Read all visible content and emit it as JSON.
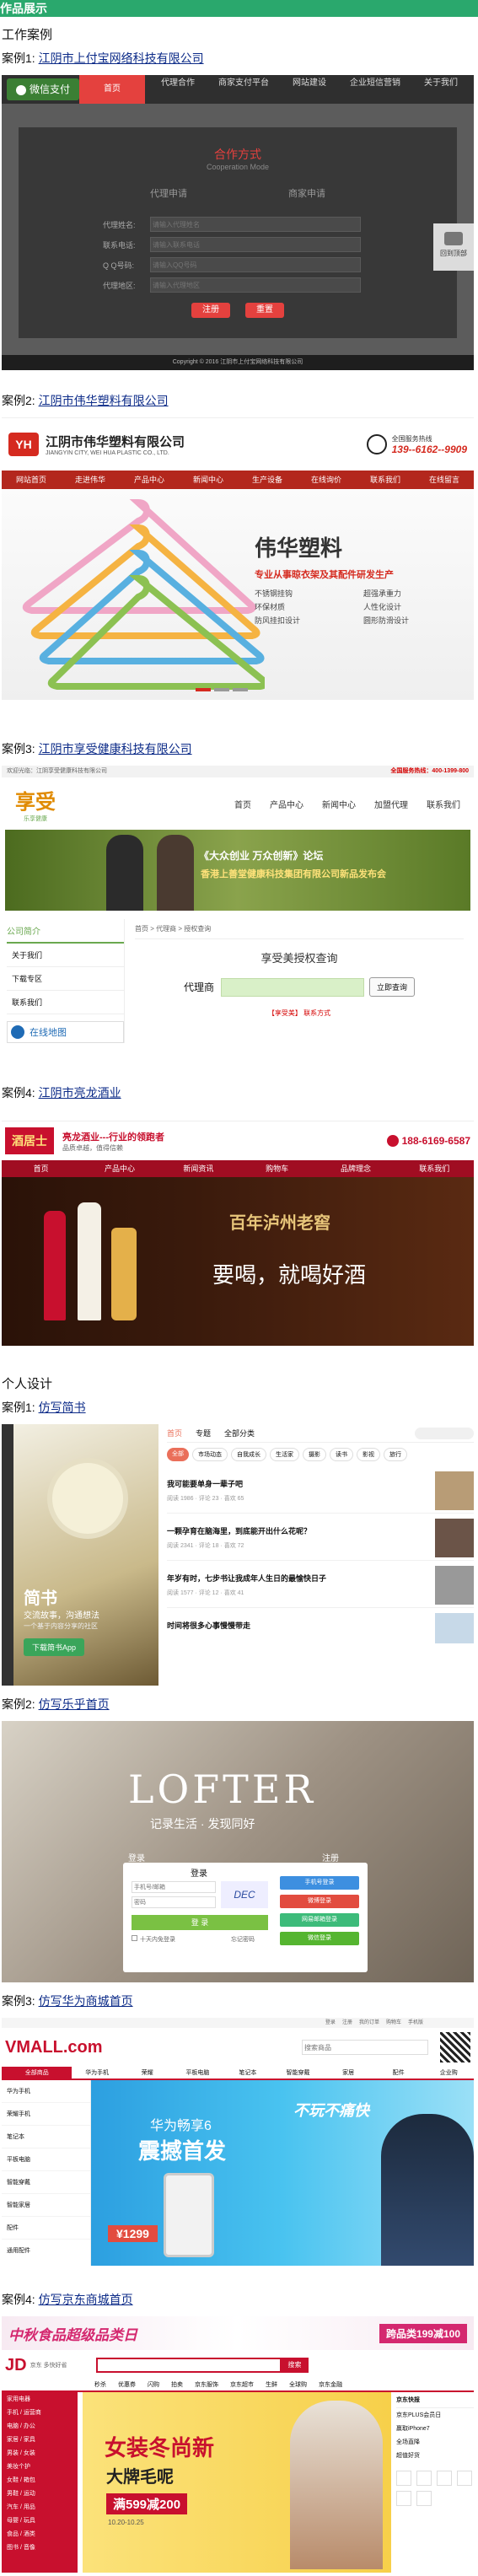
{
  "header": {
    "title": "作品展示"
  },
  "sections": {
    "work": "工作案例",
    "personal": "个人设计"
  },
  "cases": [
    {
      "label": "案例1:",
      "link": "江阴市上付宝网络科技有限公司"
    },
    {
      "label": "案例2:",
      "link": "江阴市伟华塑料有限公司"
    },
    {
      "label": "案例3:",
      "link": "江阴市享受健康科技有限公司"
    },
    {
      "label": "案例4:",
      "link": "江阴市亮龙酒业"
    },
    {
      "label": "案例1:",
      "link": "仿写简书"
    },
    {
      "label": "案例2:",
      "link": "仿写乐乎首页"
    },
    {
      "label": "案例3:",
      "link": "仿写华为商城首页"
    },
    {
      "label": "案例4:",
      "link": "仿写京东商城首页"
    }
  ],
  "s1": {
    "logo": "微信支付",
    "nav": [
      "首页",
      "代理合作",
      "商家支付平台",
      "网站建设",
      "企业短信营销",
      "关于我们"
    ],
    "title": "合作方式",
    "subtitle": "Cooperation Mode",
    "tab1": "代理申请",
    "tab2": "商家申请",
    "fields": [
      "代理姓名:",
      "联系电话:",
      "Q Q号码:",
      "代理地区:"
    ],
    "placeholders": [
      "请输入代理姓名",
      "请输入联系电话",
      "请输入QQ号码",
      "请输入代理地区"
    ],
    "btn1": "注册",
    "btn2": "重置",
    "side": "回到顶部",
    "footer": "Copyright © 2016 江阴市上付宝网络科技有限公司"
  },
  "s2": {
    "logo": "YH",
    "cn": "江阴市伟华塑料有限公司",
    "en": "JIANGYIN CITY, WEI HUA PLASTIC CO., LTD.",
    "hotline_label": "全国服务热线",
    "phone": "139--6162--9909",
    "nav": [
      "网站首页",
      "走进伟华",
      "产品中心",
      "新闻中心",
      "生产设备",
      "在线询价",
      "联系我们",
      "在线留言"
    ],
    "brand": "伟华塑料",
    "slogan": "专业从事晾衣架及其配件研发生产",
    "features": [
      "不锈钢挂钩",
      "环保材质",
      "防风挂扣设计",
      "超强承重力",
      "人性化设计",
      "圆形防滑设计"
    ]
  },
  "s3": {
    "topleft": "欢迎光临：江阴享受健康科技有限公司",
    "topright": "全国服务热线：400-1399-800",
    "logo": "享受",
    "logo_sub": "乐享健康",
    "nav": [
      "首页",
      "产品中心",
      "新闻中心",
      "加盟代理",
      "联系我们"
    ],
    "banner1": "《大众创业 万众创新》论坛",
    "banner2": "香港上善堂健康科技集团有限公司新品发布会",
    "side_title": "公司简介",
    "side_items": [
      "关于我们",
      "下载专区",
      "联系我们"
    ],
    "side_map": "在线地图",
    "crumb": "首页 > 代理商 > 授权查询",
    "query_title": "享受美授权查询",
    "query_label": "代理商",
    "query_btn": "立即查询",
    "contact": "【享受美】 联系方式"
  },
  "s4": {
    "logo": "酒居士",
    "brand_title": "亮龙酒业---行业的领跑者",
    "brand_desc": "品质卓越，值得信赖",
    "phone": "188-6169-6587",
    "nav": [
      "首页",
      "产品中心",
      "新闻资讯",
      "购物车",
      "品牌理念",
      "联系我们"
    ],
    "banner_h": "百年泸州老窖",
    "banner_main": "要喝，就喝好酒"
  },
  "s5": {
    "tabs": [
      "首页",
      "专题",
      "全部分类"
    ],
    "cats": [
      "全部",
      "市场动态",
      "自我成长",
      "生活家",
      "摄影",
      "读书",
      "影视",
      "旅行"
    ],
    "feed": [
      {
        "title": "我可能要单身一辈子吧",
        "meta": "阅读 1986 · 评论 23 · 喜欢 65"
      },
      {
        "title": "一颗孕育在脑海里，到底能开出什么花呢？",
        "meta": "阅读 2341 · 评论 18 · 喜欢 72"
      },
      {
        "title": "年岁有时，七步书让我成年人生日的最愉快日子",
        "meta": "阅读 1577 · 评论 12 · 喜欢 41"
      },
      {
        "title": "时间将很多心事慢慢带走",
        "meta": "阅读 890 · 评论 9 · 喜欢 27"
      }
    ],
    "brand": "简书",
    "brand_sub": "交流故事，沟通想法",
    "brand_desc": "一个基于内容分享的社区",
    "download": "下载简书App"
  },
  "s6": {
    "brand": "LOFTER",
    "slogan": "记录生活 · 发现同好",
    "tab_left": "登录",
    "tab_right": "注册",
    "login_title": "登录",
    "user_ph": "手机号/邮箱",
    "pass_ph": "密码",
    "login_btn": "登 录",
    "remember": "十天内免登录",
    "forgot": "忘记密码",
    "other": [
      "手机号登录",
      "微博登录",
      "网易邮箱登录",
      "微信登录"
    ]
  },
  "s7": {
    "topnav": [
      "登录",
      "注册",
      "我的订单",
      "购物车",
      "手机版"
    ],
    "logo": "VMALL.com",
    "search_ph": "搜索商品",
    "nav": [
      "全部商品",
      "华为手机",
      "荣耀",
      "平板电脑",
      "笔记本",
      "智能穿戴",
      "家居",
      "配件",
      "企业购"
    ],
    "side_items": [
      "华为手机",
      "荣耀手机",
      "笔记本",
      "平板电脑",
      "智能穿戴",
      "智能家居",
      "配件",
      "通用配件"
    ],
    "banner_a": "华为畅享6",
    "banner_b": "震撼首发",
    "price": "1299",
    "banner_right": "不玩不痛快"
  },
  "s8": {
    "promo": "中秋食品超级品类日",
    "promo_right": "跨品类199减100",
    "logo": "JD",
    "logo_sub": "京东 多快好省",
    "search_btn": "搜索",
    "nav": [
      "秒杀",
      "优惠券",
      "闪购",
      "拍卖",
      "京东服饰",
      "京东超市",
      "生鲜",
      "全球购",
      "京东金融"
    ],
    "cats": [
      "家用电器",
      "手机 / 运营商",
      "电脑 / 办公",
      "家居 / 家具",
      "男装 / 女装",
      "美妆个护",
      "女鞋 / 箱包",
      "男鞋 / 运动",
      "汽车 / 用品",
      "母婴 / 玩具",
      "食品 / 酒类",
      "图书 / 音像"
    ],
    "banner_a": "女装冬尚新",
    "banner_b": "大牌毛呢",
    "banner_c": "满599减200",
    "banner_d": "10.20-10.25",
    "news_title": "京东快报",
    "news": [
      "京东PLUS会员日",
      "赢取iPhone7",
      "全场直降",
      "超值好货"
    ]
  }
}
